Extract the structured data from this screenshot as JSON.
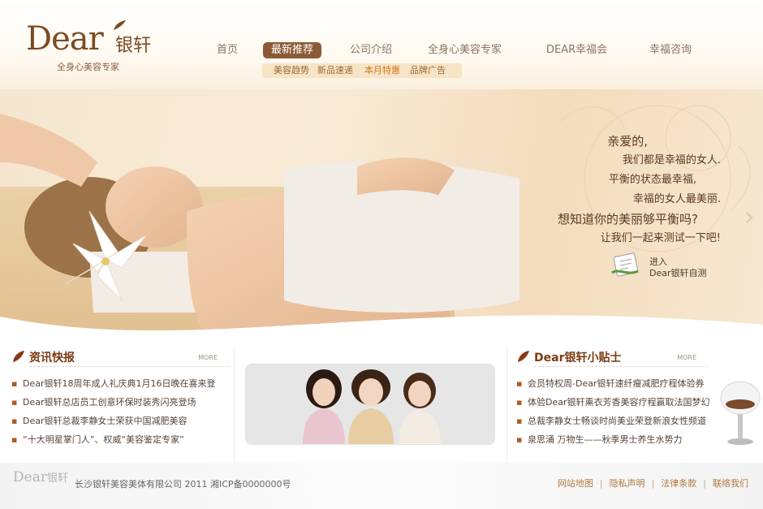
{
  "brand": {
    "logo_en": "Dear",
    "logo_cn": "银轩",
    "tagline": "全身心美容专家"
  },
  "nav": {
    "items": [
      {
        "label": "首页"
      },
      {
        "label": "最新推荐",
        "active": true
      },
      {
        "label": "公司介绍"
      },
      {
        "label": "全身心美容专家"
      },
      {
        "label": "DEAR幸福会"
      },
      {
        "label": "幸福咨询"
      }
    ],
    "sub_items": [
      {
        "label": "美容趋势"
      },
      {
        "label": "新品速递"
      },
      {
        "label": "本月特惠",
        "highlight": true
      },
      {
        "label": "品牌广告"
      }
    ]
  },
  "banner": {
    "slogan": [
      "亲爱的,",
      "我们都是幸福的女人.",
      "平衡的状态最幸福,",
      "幸福的女人最美丽.",
      "想知道你的美丽够平衡吗?",
      "让我们一起来测试一下吧!"
    ],
    "test_link": {
      "line1": "进入",
      "line2": "Dear银轩自测"
    }
  },
  "news": {
    "title": "资讯快报",
    "more": "MORE",
    "items": [
      "Dear银轩18周年成人礼庆典1月16日晚在喜来登",
      "Dear银轩总店员工创意环保时装秀闪亮登场",
      "Dear银轩总裁李静女士荣获中国减肥美容",
      "“十大明星掌门人”、权威“美容鉴定专家”"
    ]
  },
  "tips": {
    "title": "Dear银轩小贴士",
    "more": "MORE",
    "items": [
      "会员特权周-Dear银轩速纤瘦减肥疗程体验券",
      "体验Dear银轩熏衣芳香美容疗程赢取法国梦幻",
      "总裁李静女士畅谈时尚美业荣登新浪女性频道",
      "泉思涌 万物生——秋季男士养生水势力"
    ]
  },
  "footer": {
    "logo_en": "Dear",
    "logo_cn": "银轩",
    "copyright": "长沙银轩美容美体有限公司 2011 湘ICP备0000000号",
    "links": [
      "网站地图",
      "隐私声明",
      "法律条款",
      "联络我们"
    ]
  },
  "colors": {
    "brand_brown": "#7b4a22",
    "nav_active_bg": "#8a5a36",
    "subnav_bg": "#f7e3c5",
    "highlight_orange": "#d07a1a",
    "footer_link": "#b07a40"
  }
}
